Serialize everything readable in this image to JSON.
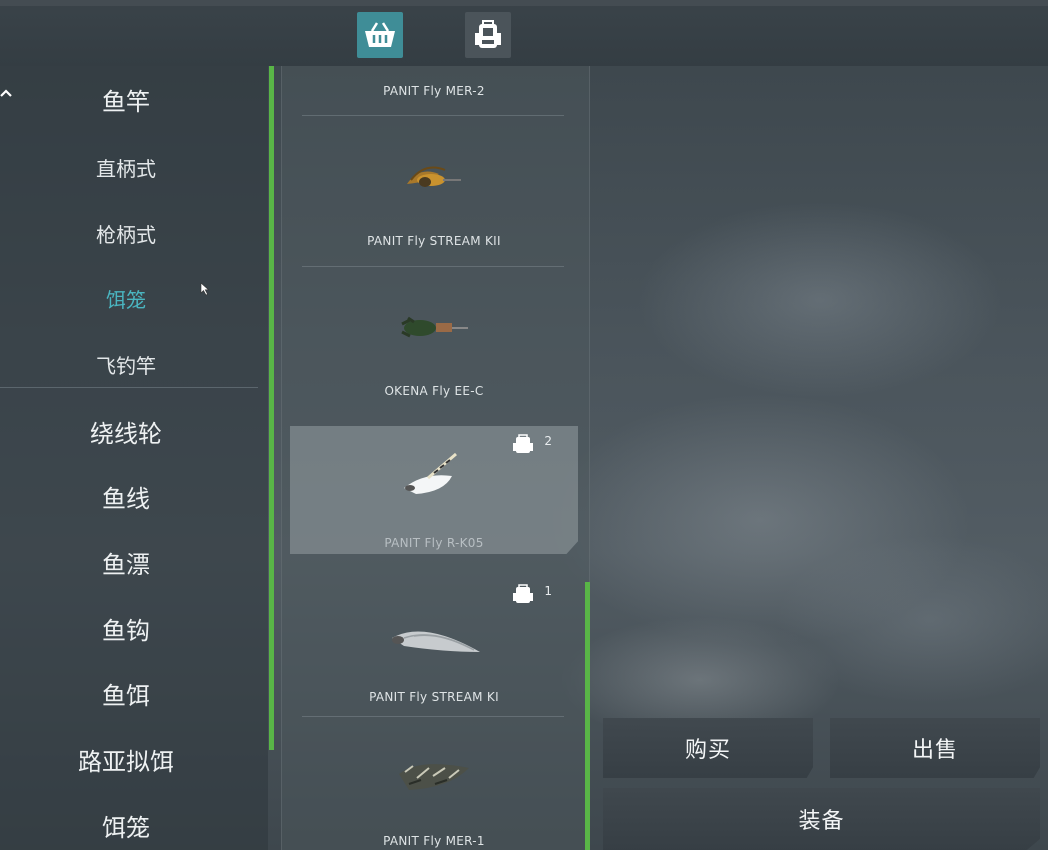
{
  "top_tabs": [
    {
      "icon": "shop-basket-icon",
      "active": true
    },
    {
      "icon": "backpack-icon",
      "active": false
    }
  ],
  "sidebar": {
    "items": [
      {
        "label": "鱼竿",
        "level": "main"
      },
      {
        "label": "直柄式",
        "level": "sub"
      },
      {
        "label": "枪柄式",
        "level": "sub"
      },
      {
        "label": "饵笼",
        "level": "sub",
        "active": true
      },
      {
        "label": "飞钓竿",
        "level": "sub"
      },
      {
        "label": "绕线轮",
        "level": "main"
      },
      {
        "label": "鱼线",
        "level": "main"
      },
      {
        "label": "鱼漂",
        "level": "main"
      },
      {
        "label": "鱼钩",
        "level": "main"
      },
      {
        "label": "鱼饵",
        "level": "main"
      },
      {
        "label": "路亚拟饵",
        "level": "main"
      },
      {
        "label": "饵笼",
        "level": "main"
      }
    ]
  },
  "items": [
    {
      "name": "PANIT Fly MER-2"
    },
    {
      "name": "PANIT Fly STREAM KII"
    },
    {
      "name": "OKENA Fly EE-C"
    },
    {
      "name": "PANIT Fly R-K05",
      "owned": "2",
      "selected": true
    },
    {
      "name": "PANIT Fly STREAM KI",
      "owned": "1"
    },
    {
      "name": "PANIT Fly MER-1"
    }
  ],
  "actions": {
    "buy": "购买",
    "sell": "出售",
    "equip": "装备"
  },
  "colors": {
    "accent": "#4ab5c0",
    "scrollbar": "#59b547",
    "active_tab": "#3f8d97"
  }
}
